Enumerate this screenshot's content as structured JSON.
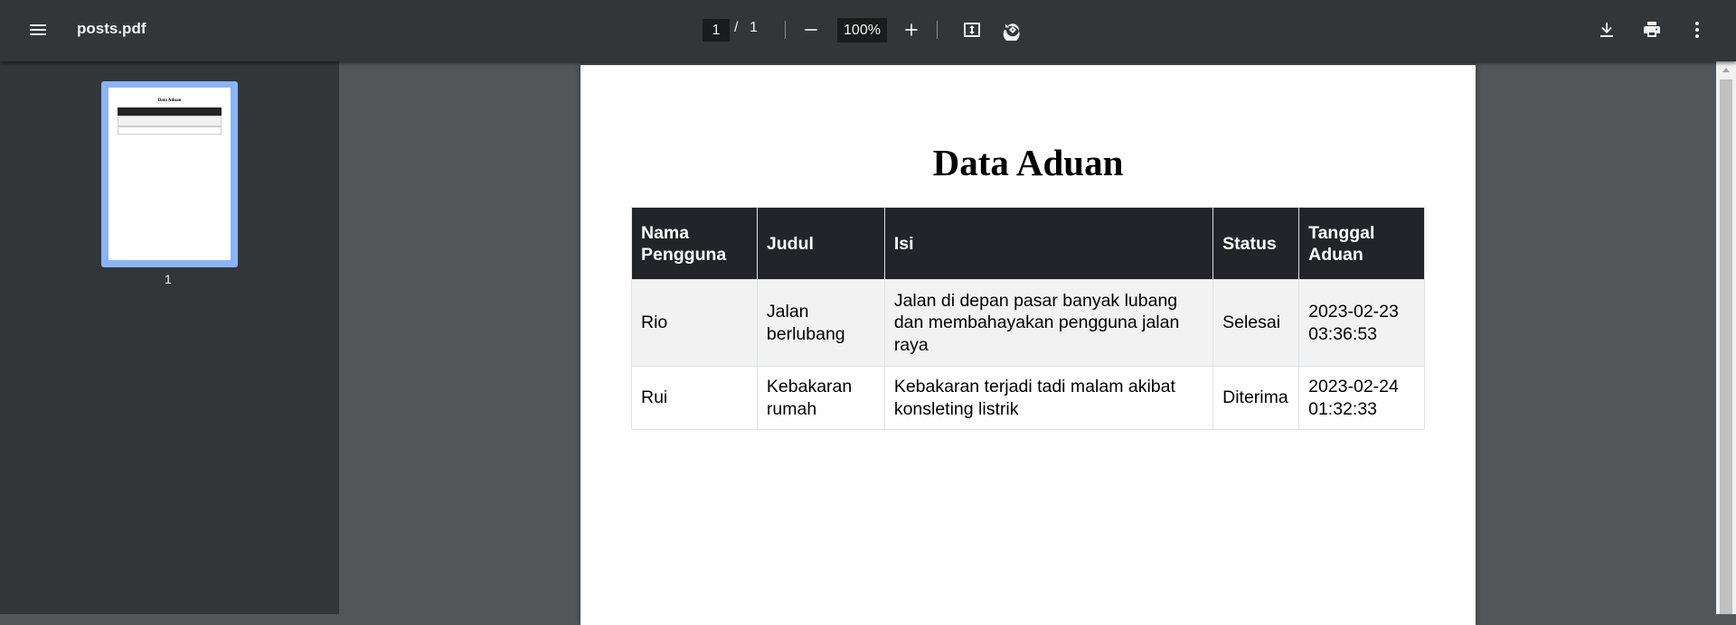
{
  "toolbar": {
    "file_name": "posts.pdf",
    "page_current": "1",
    "page_separator": "/",
    "page_total": "1",
    "zoom": "100%",
    "icons": [
      "menu-icon",
      "zoom-out-icon",
      "zoom-in-icon",
      "fit-page-icon",
      "rotate-icon",
      "download-icon",
      "print-icon",
      "more-vert-icon"
    ]
  },
  "sidebar": {
    "thumbnails": [
      {
        "label": "1"
      }
    ]
  },
  "document": {
    "title": "Data Aduan",
    "table": {
      "headers": [
        "Nama Pengguna",
        "Judul",
        "Isi",
        "Status",
        "Tanggal Aduan"
      ],
      "rows": [
        [
          "Rio",
          "Jalan berlubang",
          "Jalan di depan pasar banyak lubang dan membahayakan pengguna jalan raya",
          "Selesai",
          "2023-02-23 03:36:53"
        ],
        [
          "Rui",
          "Kebakaran rumah",
          "Kebakaran terjadi tadi malam akibat konsleting listrik",
          "Diterima",
          "2023-02-24 01:32:33"
        ]
      ]
    }
  },
  "colors": {
    "toolbar_bg": "#323639",
    "viewer_bg": "#525659",
    "thumb_selected": "#8ab4f8",
    "table_header_bg": "#212529",
    "table_stripe": "#f2f2f2"
  }
}
